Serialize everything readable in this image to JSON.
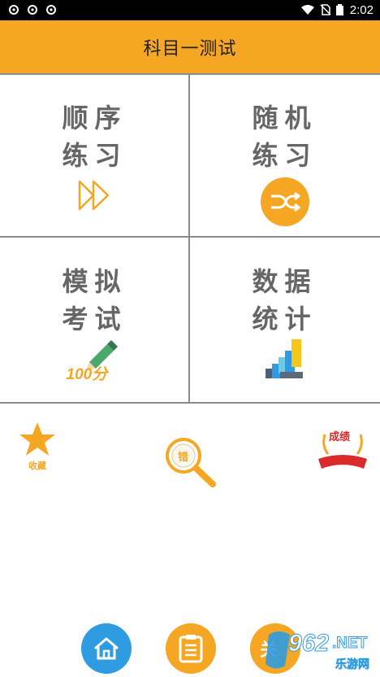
{
  "status_bar": {
    "time": "2:02",
    "icons": [
      "sync-icon",
      "sync-icon",
      "sync-icon",
      "wifi-icon",
      "no-sim-icon",
      "battery-icon"
    ]
  },
  "app_bar": {
    "title": "科目一测试"
  },
  "menu": {
    "sequential": {
      "line1": "顺序",
      "line2": "练习",
      "icon": "fast-forward-icon"
    },
    "random": {
      "line1": "随机",
      "line2": "练习",
      "icon": "shuffle-icon"
    },
    "mock_exam": {
      "line1": "模拟",
      "line2": "考试",
      "icon": "pencil-100-icon",
      "icon_text": "100分"
    },
    "statistics": {
      "line1": "数据",
      "line2": "统计",
      "icon": "bar-blocks-icon"
    }
  },
  "extras": {
    "favorites": {
      "label": "收藏",
      "icon": "star-icon"
    },
    "mistakes": {
      "label": "错",
      "icon": "magnifier-icon"
    },
    "scores": {
      "label": "成绩",
      "icon": "ribbon-icon"
    }
  },
  "bottom_nav": {
    "home": {
      "icon": "home-icon"
    },
    "list": {
      "icon": "clipboard-icon"
    },
    "about": {
      "label": "关",
      "icon": "about-icon"
    }
  },
  "watermark": {
    "text": "962",
    "suffix": ".NET",
    "sub": "乐游网"
  },
  "colors": {
    "accent": "#f5a623",
    "grid_line": "#8b8b8b",
    "label_gray": "#666666",
    "blue": "#2f9be0"
  }
}
